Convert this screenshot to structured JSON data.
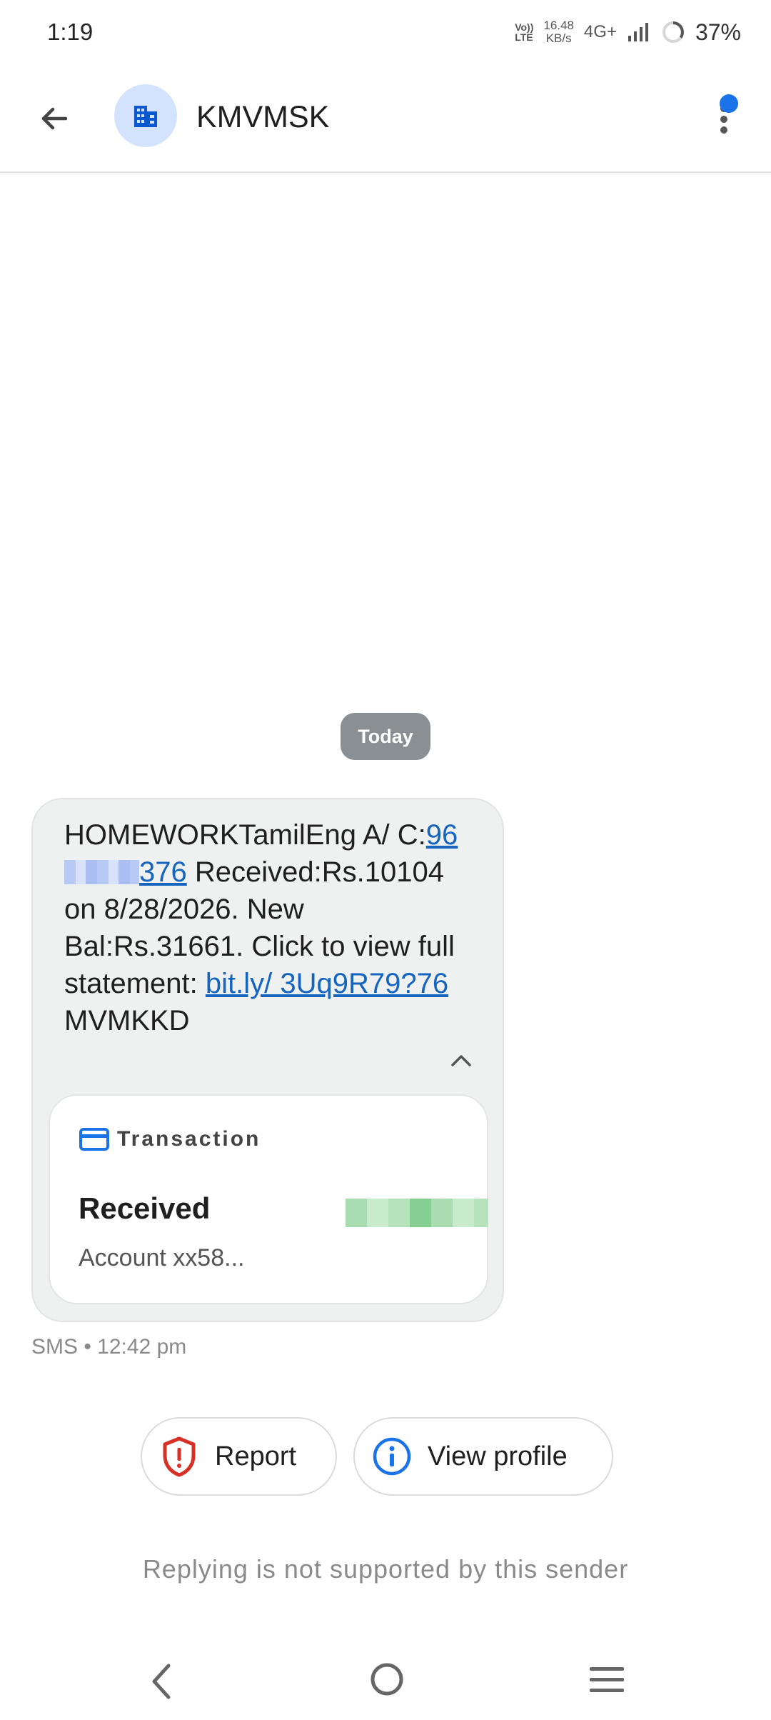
{
  "status_bar": {
    "time": "1:19",
    "volte_top": "Vo))",
    "volte_bottom": "LTE",
    "net_speed_value": "16.48",
    "net_speed_unit": "KB/s",
    "network_type": "4G+",
    "battery_percent": "37%"
  },
  "app_bar": {
    "contact_name": "KMVMSK",
    "unread_dot_color": "#1a73e8"
  },
  "conversation": {
    "date_chip": "Today",
    "message": {
      "text_before": "HOMEWORKTamilEng A/ C:",
      "account_link_start": "96",
      "account_link_end": "376",
      "text_middle": " Received:Rs.10104 on 8/28/2026. New Bal:Rs.31661. Click to view full statement: ",
      "url_link": "bit.ly/ 3Uq9R79?76",
      "text_after": " MVMKKD"
    },
    "card": {
      "icon": "credit-card-icon",
      "title": "Transaction",
      "status": "Received",
      "account": "Account xx58..."
    },
    "meta": "SMS • 12:42 pm"
  },
  "actions": {
    "report_label": "Report",
    "view_profile_label": "View profile"
  },
  "footer_note": "Replying is not supported by this sender",
  "colors": {
    "accent_blue": "#1a73e8",
    "report_red": "#d93025",
    "bubble_bg": "#eff1f1"
  }
}
